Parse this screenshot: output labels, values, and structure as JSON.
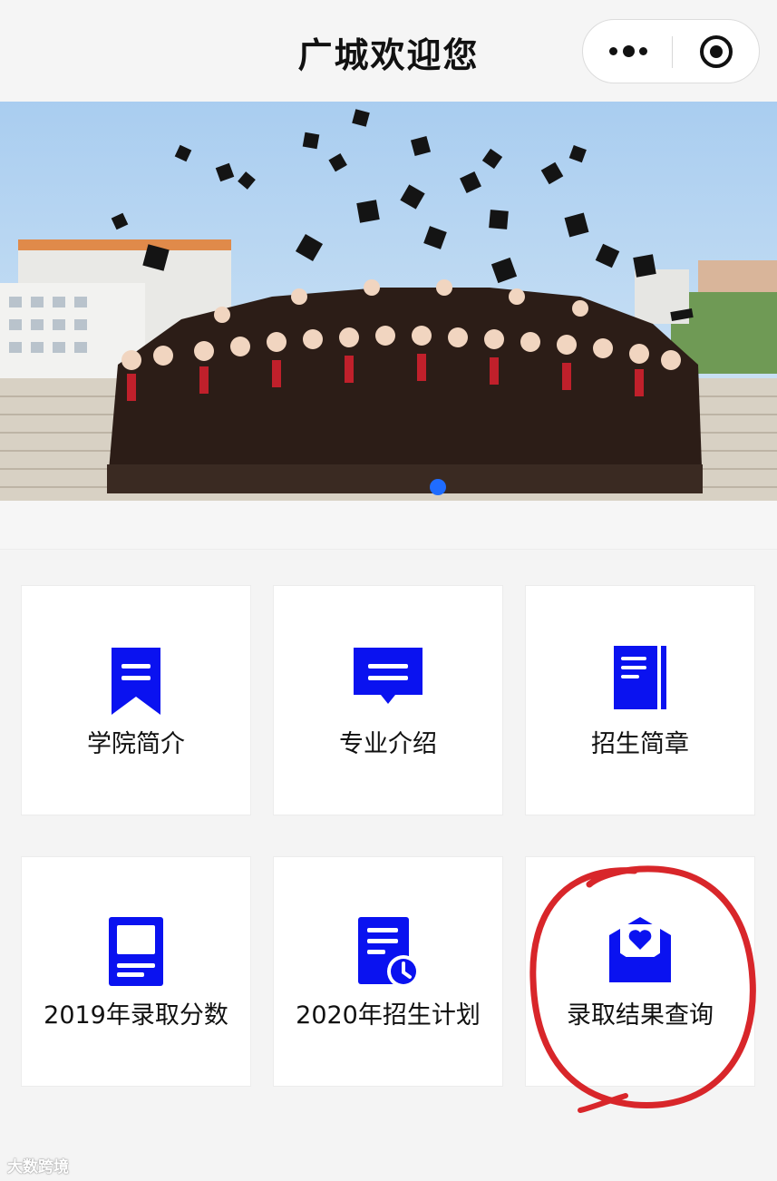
{
  "nav": {
    "title": "广城欢迎您",
    "more_icon": "more-dots-icon",
    "close_icon": "record-circle-icon"
  },
  "banner": {
    "image": "graduation-photo",
    "page_indicator": {
      "current": 1,
      "total": 1
    }
  },
  "menu": {
    "items": [
      {
        "label": "学院简介",
        "icon": "bookmark-list-icon"
      },
      {
        "label": "专业介绍",
        "icon": "chat-bubble-icon"
      },
      {
        "label": "招生简章",
        "icon": "document-icon"
      },
      {
        "label": "2019年录取分数",
        "icon": "tablet-doc-icon"
      },
      {
        "label": "2020年招生计划",
        "icon": "doc-clock-icon"
      },
      {
        "label": "录取结果查询",
        "icon": "heart-envelope-icon"
      }
    ]
  },
  "colors": {
    "icon_blue": "#0a12f0",
    "annotation_red": "#d8262a",
    "indicator_blue": "#1f6cff"
  },
  "watermark": {
    "text": "大数跨境"
  }
}
